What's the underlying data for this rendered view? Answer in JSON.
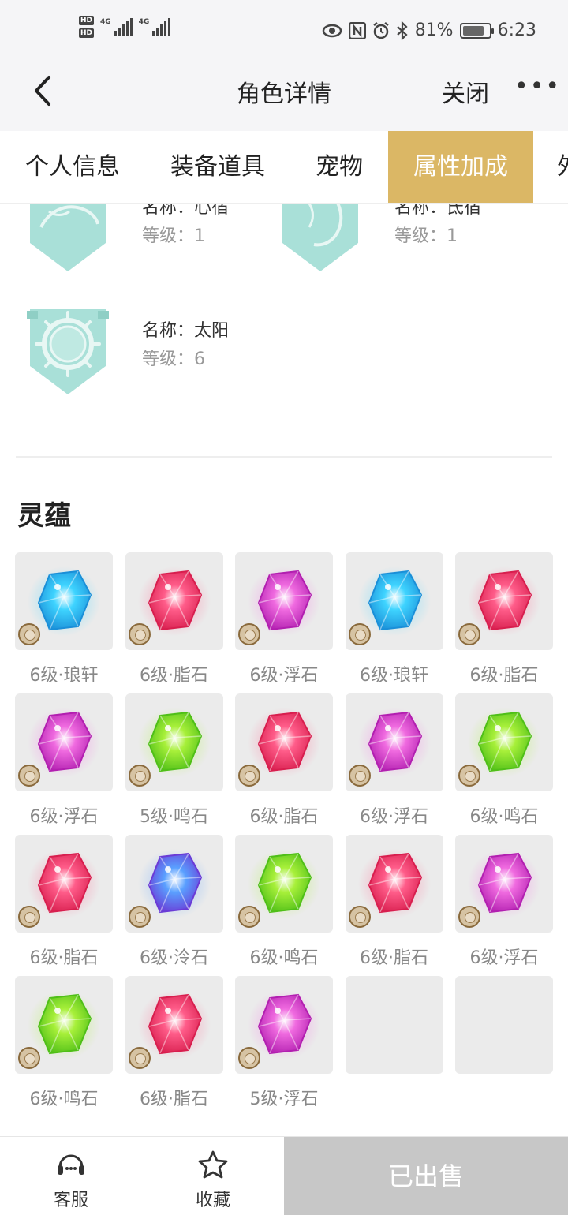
{
  "status_bar": {
    "hd1": "HD",
    "hd2": "HD",
    "net1": "4G",
    "net2": "4G",
    "battery": "81%",
    "battery_level": 0.81,
    "time": "6:23"
  },
  "nav": {
    "title": "角色详情",
    "close": "关闭",
    "more": "•••"
  },
  "tabs": [
    {
      "label": "个人信息",
      "active": false
    },
    {
      "label": "装备道具",
      "active": false
    },
    {
      "label": "宠物",
      "active": false
    },
    {
      "label": "属性加成",
      "active": true
    },
    {
      "label": "外",
      "active": false
    }
  ],
  "emblems": [
    {
      "name": "名称：心宿",
      "level": "等级：1"
    },
    {
      "name": "名称：氐宿",
      "level": "等级：1"
    },
    {
      "name": "名称：太阳",
      "level": "等级：6"
    }
  ],
  "section": {
    "title": "灵蕴"
  },
  "lingyun": [
    {
      "label": "6级·琅轩",
      "gem": "blue-gem"
    },
    {
      "label": "6级·脂石",
      "gem": "red-gem"
    },
    {
      "label": "6级·浮石",
      "gem": "pink-gem"
    },
    {
      "label": "6级·琅轩",
      "gem": "blue-gem"
    },
    {
      "label": "6级·脂石",
      "gem": "red-gem"
    },
    {
      "label": "6级·浮石",
      "gem": "pink-gem"
    },
    {
      "label": "5级·鸣石",
      "gem": "green-gem"
    },
    {
      "label": "6级·脂石",
      "gem": "red-gem"
    },
    {
      "label": "6级·浮石",
      "gem": "pink-gem"
    },
    {
      "label": "6级·鸣石",
      "gem": "green-gem"
    },
    {
      "label": "6级·脂石",
      "gem": "red-gem"
    },
    {
      "label": "6级·泠石",
      "gem": "violet-gem"
    },
    {
      "label": "6级·鸣石",
      "gem": "green-gem"
    },
    {
      "label": "6级·脂石",
      "gem": "red-gem"
    },
    {
      "label": "6级·浮石",
      "gem": "pink-gem"
    },
    {
      "label": "6级·鸣石",
      "gem": "green-gem"
    },
    {
      "label": "6级·脂石",
      "gem": "red-gem"
    },
    {
      "label": "5级·浮石",
      "gem": "pink-gem"
    },
    {
      "label": "",
      "gem": ""
    },
    {
      "label": "",
      "gem": ""
    }
  ],
  "gem_colors": {
    "blue-gem": [
      "#3fd4ff",
      "#1a8fd8"
    ],
    "red-gem": [
      "#ff5d8a",
      "#d81e4e"
    ],
    "pink-gem": [
      "#f06be0",
      "#b21fb0"
    ],
    "green-gem": [
      "#a8f03a",
      "#4fbf17"
    ],
    "violet-gem": [
      "#5aa0ff",
      "#6a3bd6"
    ]
  },
  "bottom": {
    "service": "客服",
    "favorite": "收藏",
    "sold": "已出售"
  },
  "colors": {
    "accent": "#dbb765",
    "sold_bg": "#c7c7c7"
  }
}
